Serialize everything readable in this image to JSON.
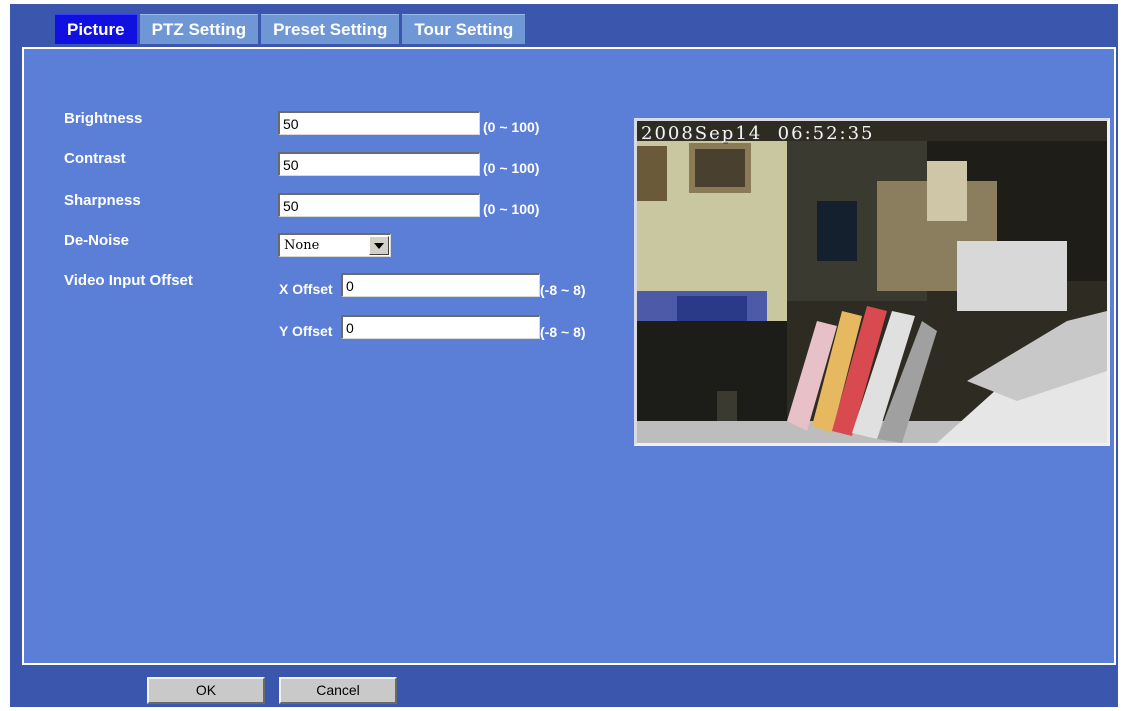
{
  "tabs": [
    {
      "label": "Picture",
      "active": true
    },
    {
      "label": "PTZ Setting",
      "active": false
    },
    {
      "label": "Preset Setting",
      "active": false
    },
    {
      "label": "Tour Setting",
      "active": false
    }
  ],
  "settings": {
    "brightness": {
      "label": "Brightness",
      "value": "50",
      "range": "(0 ~ 100)"
    },
    "contrast": {
      "label": "Contrast",
      "value": "50",
      "range": "(0 ~ 100)"
    },
    "sharpness": {
      "label": "Sharpness",
      "value": "50",
      "range": "(0 ~ 100)"
    },
    "denoise": {
      "label": "De-Noise",
      "selected": "None"
    },
    "video_input_offset": {
      "label": "Video Input Offset",
      "x_label": "X Offset",
      "x_value": "0",
      "x_range": "(-8 ~ 8)",
      "y_label": "Y Offset",
      "y_value": "0",
      "y_range": "(-8 ~ 8)"
    }
  },
  "preview": {
    "timestamp": "2008Sep14  06:52:35"
  },
  "buttons": {
    "ok": "OK",
    "cancel": "Cancel"
  },
  "colors": {
    "frame": "#3a57ad",
    "panel": "#5b7fd6",
    "tab_active": "#1010e0",
    "tab_inactive": "#6f97d6"
  }
}
